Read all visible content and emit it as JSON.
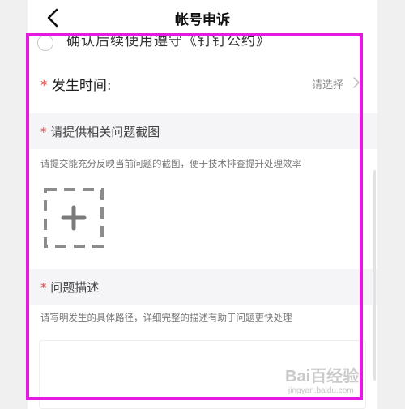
{
  "header": {
    "title": "帐号申诉"
  },
  "agreement": {
    "text": "确认后续使用遵守《钉钉公约》"
  },
  "occurrence_time": {
    "required_mark": "*",
    "label": "发生时间:",
    "value": "请选择"
  },
  "screenshot_section": {
    "required_mark": "*",
    "title": "请提供相关问题截图",
    "hint": "请提交能充分反映当前问题的截图，便于技术排查提升处理效率"
  },
  "description_section": {
    "required_mark": "*",
    "title": "问题描述",
    "hint": "请写明发生的具体路径，详细完整的描述有助于问题更快处理"
  },
  "watermark": {
    "brand": "Bai百经验",
    "sub": "jingyan.baidu.com"
  },
  "colors": {
    "required": "#e8413b",
    "highlight": "#e619e1",
    "section_bg": "#f5f5f7"
  },
  "icons": {
    "back": "chevron-left-icon",
    "forward": "chevron-right-icon",
    "upload": "plus-icon"
  }
}
